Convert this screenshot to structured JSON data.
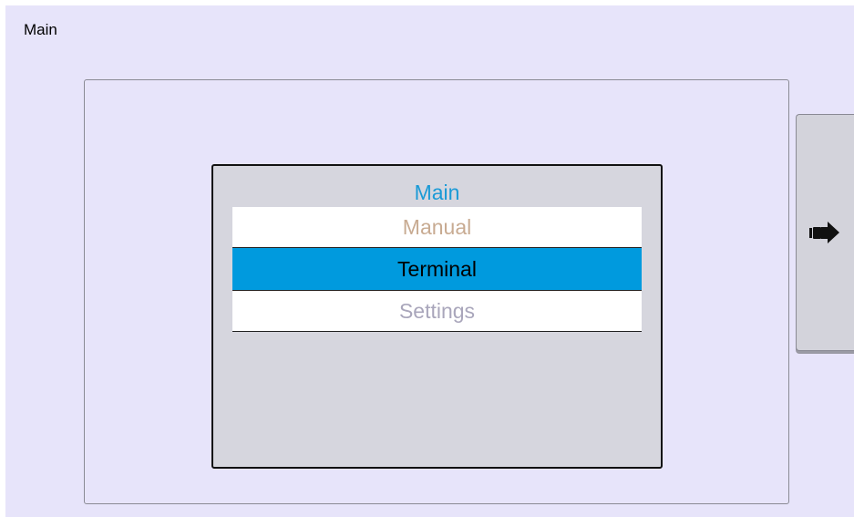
{
  "page": {
    "title": "Main"
  },
  "menu": {
    "header": "Main",
    "items": [
      {
        "label": "Manual",
        "color": "#c8ab92",
        "selected": false
      },
      {
        "label": "Terminal",
        "color": "#000000",
        "selected": true
      },
      {
        "label": "Settings",
        "color": "#a9a6bb",
        "selected": false
      }
    ]
  },
  "side_button": {
    "icon": "pointing-hand-right-icon"
  },
  "colors": {
    "background": "#e7e4fa",
    "header_accent": "#1a9ad6",
    "selection": "#009ade"
  }
}
